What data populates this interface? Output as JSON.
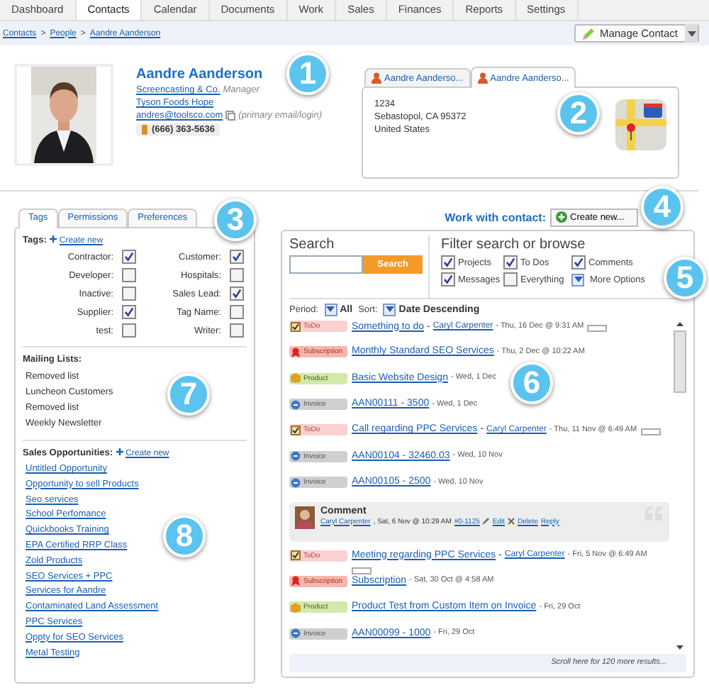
{
  "top_tabs": [
    {
      "label": "Dashboard",
      "selected": false
    },
    {
      "label": "Contacts",
      "selected": true
    },
    {
      "label": "Calendar",
      "selected": false
    },
    {
      "label": "Documents",
      "selected": false
    },
    {
      "label": "Work",
      "selected": false
    },
    {
      "label": "Sales",
      "selected": false
    },
    {
      "label": "Finances",
      "selected": false
    },
    {
      "label": "Reports",
      "selected": false
    },
    {
      "label": "Settings",
      "selected": false
    }
  ],
  "breadcrumb": {
    "items": [
      "Contacts",
      "People",
      "Aandre Aanderson"
    ],
    "separator": ">"
  },
  "manage_button": "Manage Contact",
  "contact": {
    "name": "Aandre Aanderson",
    "company": "Screencasting & Co.",
    "role": "Manager",
    "org": "Tyson Foods Hope",
    "email": "andres@toolsco.com",
    "email_note": "(primary email/login)",
    "phone": "(666) 363-5636"
  },
  "address_tabs": [
    {
      "label": "Aandre Aanderso...",
      "selected": false
    },
    {
      "label": "Aandre Aanderso...",
      "selected": true
    }
  ],
  "address": [
    "1234",
    "Sebastopol, CA 95372",
    "United States"
  ],
  "callouts": [
    "1",
    "2",
    "3",
    "4",
    "5",
    "6",
    "7",
    "8"
  ],
  "side_tabs": [
    {
      "label": "Tags",
      "selected": true
    },
    {
      "label": "Permissions",
      "selected": false
    },
    {
      "label": "Preferences",
      "selected": false
    }
  ],
  "tags": {
    "title": "Tags:",
    "create": "Create new",
    "items": [
      {
        "label": "Contractor:",
        "checked": true
      },
      {
        "label": "Customer:",
        "checked": true
      },
      {
        "label": "Developer:",
        "checked": false
      },
      {
        "label": "Hospitals:",
        "checked": false
      },
      {
        "label": "Inactive:",
        "checked": false
      },
      {
        "label": "Sales Lead:",
        "checked": true
      },
      {
        "label": "Supplier:",
        "checked": true
      },
      {
        "label": "Tag Name:",
        "checked": false
      },
      {
        "label": "test:",
        "checked": false
      },
      {
        "label": "Writer:",
        "checked": false
      }
    ]
  },
  "mailing": {
    "title": "Mailing Lists:",
    "items": [
      "Removed list",
      "Luncheon Customers",
      "Removed list",
      "Weekly Newsletter"
    ]
  },
  "opportunities": {
    "title": "Sales Opportunities:",
    "create": "Create new",
    "items": [
      "Untitled Opportunity",
      "Opportunity to sell Products",
      "Seo services",
      "School Perfomance",
      "Quickbooks Training",
      "EPA Certified RRP Class",
      "Zold Products",
      "SEO Services + PPC",
      "Services for Aandre",
      "Contaminated Land Assessment",
      "PPC Services",
      "Oppty for SEO Services",
      "Metal Testing"
    ]
  },
  "work": {
    "title": "Work with contact:",
    "create_button": "Create new..."
  },
  "search": {
    "title": "Search",
    "button": "Search"
  },
  "filter": {
    "title": "Filter search or browse",
    "options": [
      {
        "label": "Projects",
        "checked": true
      },
      {
        "label": "To Dos",
        "checked": true
      },
      {
        "label": "Comments",
        "checked": true
      },
      {
        "label": "Messages",
        "checked": true
      },
      {
        "label": "Everything",
        "checked": false
      }
    ],
    "more": "More Options"
  },
  "period": {
    "label": "Period:",
    "value": "All"
  },
  "sort": {
    "label": "Sort:",
    "value": "Date Descending"
  },
  "feed_separator": "-",
  "feed": [
    {
      "kind": "todo",
      "badge": "ToDo",
      "title": "Something to do",
      "author": "Caryl Carpenter",
      "date": "- Thu, 16 Dec @ 9:31 AM"
    },
    {
      "kind": "subscription",
      "badge": "Subscription",
      "title": "Monthly Standard SEO Services",
      "date": "- Thu, 2 Dec @ 10:22 AM"
    },
    {
      "kind": "product",
      "badge": "Product",
      "title": "Basic Website Design",
      "date": "- Wed, 1 Dec"
    },
    {
      "kind": "invoice",
      "badge": "Invoice",
      "title": "AAN00111 - 3500",
      "date": "- Wed, 1 Dec"
    },
    {
      "kind": "todo",
      "badge": "ToDo",
      "title": "Call regarding PPC Services",
      "author": "Caryl Carpenter",
      "date": "- Thu, 11 Nov @ 6:49 AM"
    },
    {
      "kind": "invoice",
      "badge": "Invoice",
      "title": "AAN00104 - 32460.03",
      "date": "- Wed, 10 Nov"
    },
    {
      "kind": "invoice",
      "badge": "Invoice",
      "title": "AAN00105 - 2500",
      "date": "- Wed, 10 Nov"
    },
    {
      "kind": "comment",
      "title": "Comment",
      "author": "Caryl Carpenter",
      "date": ", Sat, 6 Nov @ 10:29 AM",
      "ref": "#0-1125",
      "actions": [
        "Edit",
        "Delete",
        "Reply"
      ]
    },
    {
      "kind": "todo",
      "badge": "ToDo",
      "title": "Meeting regarding PPC Services",
      "author": "Caryl Carpenter",
      "date": "- Fri, 5 Nov @ 6:49 AM"
    },
    {
      "kind": "subscription",
      "badge": "Subscription",
      "title": "Subscription",
      "date": "- Sat, 30 Oct @ 4:58 AM"
    },
    {
      "kind": "product",
      "badge": "Product",
      "title": "Product Test from Custom Item on Invoice",
      "date": "- Fri, 29 Oct"
    },
    {
      "kind": "invoice",
      "badge": "Invoice",
      "title": "AAN00099 - 1000",
      "date": "- Fri, 29 Oct"
    }
  ],
  "scroll_hint": "Scroll here for 120 more results..."
}
